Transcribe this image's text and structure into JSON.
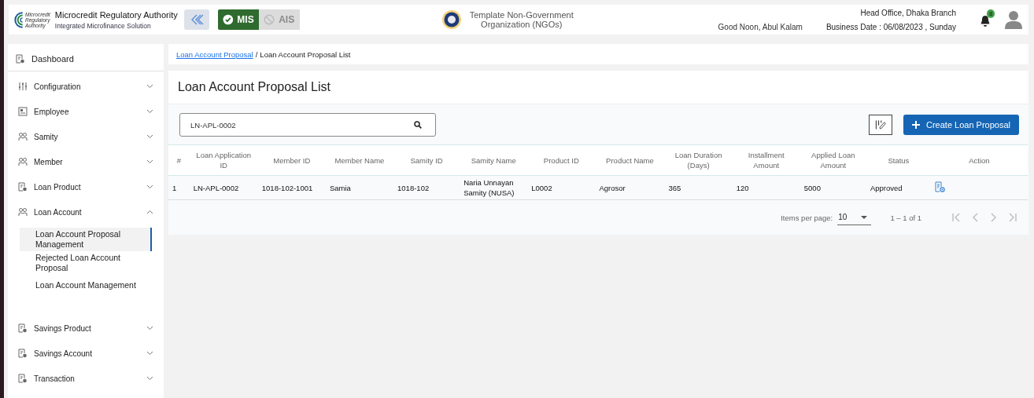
{
  "header": {
    "org_name": "Microcredit Regulatory Authority",
    "org_subtitle": "Integrated Microfinance Solution",
    "logo_text": [
      "Microcredit",
      "Regulatory",
      "Authority"
    ],
    "modes": [
      {
        "label": "MIS",
        "selected": true
      },
      {
        "label": "AIS",
        "selected": false
      }
    ],
    "ngo_name": [
      "Template Non-Government",
      "Organization (NGOs)"
    ],
    "greeting": "Good Noon, Abul Kalam",
    "branch": "Head Office, Dhaka Branch",
    "business_date": "Business Date : 06/08/2023 , Sunday",
    "notification_count": "8"
  },
  "sidebar": {
    "items": [
      {
        "label": "Dashboard",
        "kind": "top"
      },
      {
        "label": "Configuration",
        "kind": "group",
        "expanded": false
      },
      {
        "label": "Employee",
        "kind": "group",
        "expanded": false
      },
      {
        "label": "Samity",
        "kind": "group",
        "expanded": false
      },
      {
        "label": "Member",
        "kind": "group",
        "expanded": false
      },
      {
        "label": "Loan Product",
        "kind": "group",
        "expanded": false
      },
      {
        "label": "Loan Account",
        "kind": "group",
        "expanded": true,
        "children": [
          {
            "label": "Loan Account Proposal Management",
            "selected": true
          },
          {
            "label": "Rejected Loan Account Proposal",
            "selected": false
          },
          {
            "label": "Loan Account Management",
            "selected": false
          }
        ]
      },
      {
        "label": "Savings Product",
        "kind": "group",
        "expanded": false
      },
      {
        "label": "Savings Account",
        "kind": "group",
        "expanded": false
      },
      {
        "label": "Transaction",
        "kind": "group",
        "expanded": false
      }
    ]
  },
  "breadcrumb": [
    {
      "label": "Loan Account Proposal",
      "kind": "link"
    },
    {
      "label": "/",
      "kind": "separator"
    },
    {
      "label": "Loan Account Proposal List",
      "kind": "current"
    }
  ],
  "page_title": "Loan Account Proposal List",
  "search": {
    "value": "LN-APL-0002"
  },
  "create_button": "Create Loan Proposal",
  "table": {
    "columns": [
      "#",
      "Loan Application ID",
      "Member ID",
      "Member Name",
      "Samity ID",
      "Samity Name",
      "Product ID",
      "Product Name",
      "Loan Duration (Days)",
      "Installment Amount",
      "Applied Loan Amount",
      "Status",
      "Action"
    ],
    "rows": [
      {
        "cells": [
          "1",
          "LN-APL-0002",
          "1018-102-1001",
          "Samia",
          "1018-102",
          "Naria Unnayan Samity (NUSA)",
          "L0002",
          "Agrosor",
          "365",
          "120",
          "5000",
          "Approved"
        ]
      }
    ]
  },
  "paginator": {
    "label": "Items per page:",
    "page_size": "10",
    "range": "1 – 1 of 1"
  }
}
